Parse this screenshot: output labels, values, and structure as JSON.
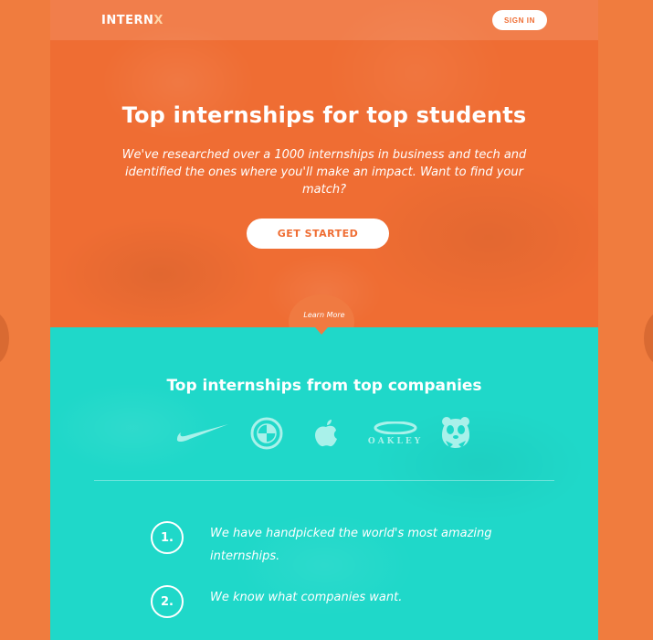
{
  "navbar": {
    "logo_main": "INTERN",
    "logo_accent": "X",
    "sign_in_label": "SIGN IN"
  },
  "hero": {
    "title": "Top internships for top students",
    "subtitle": "We've researched over a 1000 internships in business and tech and identified the ones where you'll make an impact. Want to find your match?",
    "cta_label": "GET STARTED",
    "learn_more_label": "Learn More"
  },
  "companies": {
    "title": "Top internships from top companies",
    "logos": [
      "nike-logo",
      "bmw-logo",
      "apple-logo",
      "oakley-logo",
      "wwf-logo"
    ],
    "oakley_text": "OAKLEY"
  },
  "steps": [
    {
      "number": "1.",
      "text": "We have handpicked the world's most amazing internships."
    },
    {
      "number": "2.",
      "text": "We know what companies want."
    }
  ],
  "colors": {
    "page_background": "#f07c3e",
    "hero_orange": "#ef6d33",
    "section_teal": "#1fd8c9",
    "logo_tint": "#a9f1ea"
  }
}
